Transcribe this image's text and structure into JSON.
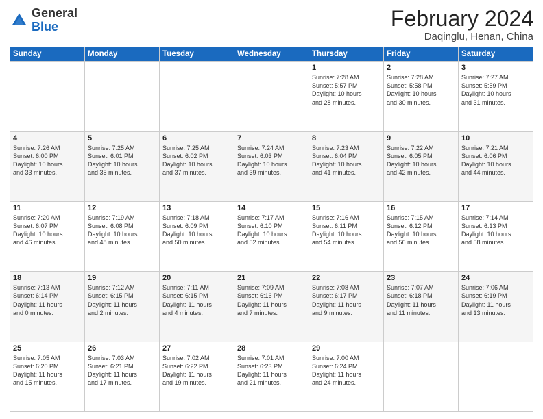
{
  "header": {
    "logo_general": "General",
    "logo_blue": "Blue",
    "month_year": "February 2024",
    "location": "Daqinglu, Henan, China"
  },
  "weekdays": [
    "Sunday",
    "Monday",
    "Tuesday",
    "Wednesday",
    "Thursday",
    "Friday",
    "Saturday"
  ],
  "weeks": [
    [
      {
        "day": "",
        "info": ""
      },
      {
        "day": "",
        "info": ""
      },
      {
        "day": "",
        "info": ""
      },
      {
        "day": "",
        "info": ""
      },
      {
        "day": "1",
        "info": "Sunrise: 7:28 AM\nSunset: 5:57 PM\nDaylight: 10 hours\nand 28 minutes."
      },
      {
        "day": "2",
        "info": "Sunrise: 7:28 AM\nSunset: 5:58 PM\nDaylight: 10 hours\nand 30 minutes."
      },
      {
        "day": "3",
        "info": "Sunrise: 7:27 AM\nSunset: 5:59 PM\nDaylight: 10 hours\nand 31 minutes."
      }
    ],
    [
      {
        "day": "4",
        "info": "Sunrise: 7:26 AM\nSunset: 6:00 PM\nDaylight: 10 hours\nand 33 minutes."
      },
      {
        "day": "5",
        "info": "Sunrise: 7:25 AM\nSunset: 6:01 PM\nDaylight: 10 hours\nand 35 minutes."
      },
      {
        "day": "6",
        "info": "Sunrise: 7:25 AM\nSunset: 6:02 PM\nDaylight: 10 hours\nand 37 minutes."
      },
      {
        "day": "7",
        "info": "Sunrise: 7:24 AM\nSunset: 6:03 PM\nDaylight: 10 hours\nand 39 minutes."
      },
      {
        "day": "8",
        "info": "Sunrise: 7:23 AM\nSunset: 6:04 PM\nDaylight: 10 hours\nand 41 minutes."
      },
      {
        "day": "9",
        "info": "Sunrise: 7:22 AM\nSunset: 6:05 PM\nDaylight: 10 hours\nand 42 minutes."
      },
      {
        "day": "10",
        "info": "Sunrise: 7:21 AM\nSunset: 6:06 PM\nDaylight: 10 hours\nand 44 minutes."
      }
    ],
    [
      {
        "day": "11",
        "info": "Sunrise: 7:20 AM\nSunset: 6:07 PM\nDaylight: 10 hours\nand 46 minutes."
      },
      {
        "day": "12",
        "info": "Sunrise: 7:19 AM\nSunset: 6:08 PM\nDaylight: 10 hours\nand 48 minutes."
      },
      {
        "day": "13",
        "info": "Sunrise: 7:18 AM\nSunset: 6:09 PM\nDaylight: 10 hours\nand 50 minutes."
      },
      {
        "day": "14",
        "info": "Sunrise: 7:17 AM\nSunset: 6:10 PM\nDaylight: 10 hours\nand 52 minutes."
      },
      {
        "day": "15",
        "info": "Sunrise: 7:16 AM\nSunset: 6:11 PM\nDaylight: 10 hours\nand 54 minutes."
      },
      {
        "day": "16",
        "info": "Sunrise: 7:15 AM\nSunset: 6:12 PM\nDaylight: 10 hours\nand 56 minutes."
      },
      {
        "day": "17",
        "info": "Sunrise: 7:14 AM\nSunset: 6:13 PM\nDaylight: 10 hours\nand 58 minutes."
      }
    ],
    [
      {
        "day": "18",
        "info": "Sunrise: 7:13 AM\nSunset: 6:14 PM\nDaylight: 11 hours\nand 0 minutes."
      },
      {
        "day": "19",
        "info": "Sunrise: 7:12 AM\nSunset: 6:15 PM\nDaylight: 11 hours\nand 2 minutes."
      },
      {
        "day": "20",
        "info": "Sunrise: 7:11 AM\nSunset: 6:15 PM\nDaylight: 11 hours\nand 4 minutes."
      },
      {
        "day": "21",
        "info": "Sunrise: 7:09 AM\nSunset: 6:16 PM\nDaylight: 11 hours\nand 7 minutes."
      },
      {
        "day": "22",
        "info": "Sunrise: 7:08 AM\nSunset: 6:17 PM\nDaylight: 11 hours\nand 9 minutes."
      },
      {
        "day": "23",
        "info": "Sunrise: 7:07 AM\nSunset: 6:18 PM\nDaylight: 11 hours\nand 11 minutes."
      },
      {
        "day": "24",
        "info": "Sunrise: 7:06 AM\nSunset: 6:19 PM\nDaylight: 11 hours\nand 13 minutes."
      }
    ],
    [
      {
        "day": "25",
        "info": "Sunrise: 7:05 AM\nSunset: 6:20 PM\nDaylight: 11 hours\nand 15 minutes."
      },
      {
        "day": "26",
        "info": "Sunrise: 7:03 AM\nSunset: 6:21 PM\nDaylight: 11 hours\nand 17 minutes."
      },
      {
        "day": "27",
        "info": "Sunrise: 7:02 AM\nSunset: 6:22 PM\nDaylight: 11 hours\nand 19 minutes."
      },
      {
        "day": "28",
        "info": "Sunrise: 7:01 AM\nSunset: 6:23 PM\nDaylight: 11 hours\nand 21 minutes."
      },
      {
        "day": "29",
        "info": "Sunrise: 7:00 AM\nSunset: 6:24 PM\nDaylight: 11 hours\nand 24 minutes."
      },
      {
        "day": "",
        "info": ""
      },
      {
        "day": "",
        "info": ""
      }
    ]
  ]
}
